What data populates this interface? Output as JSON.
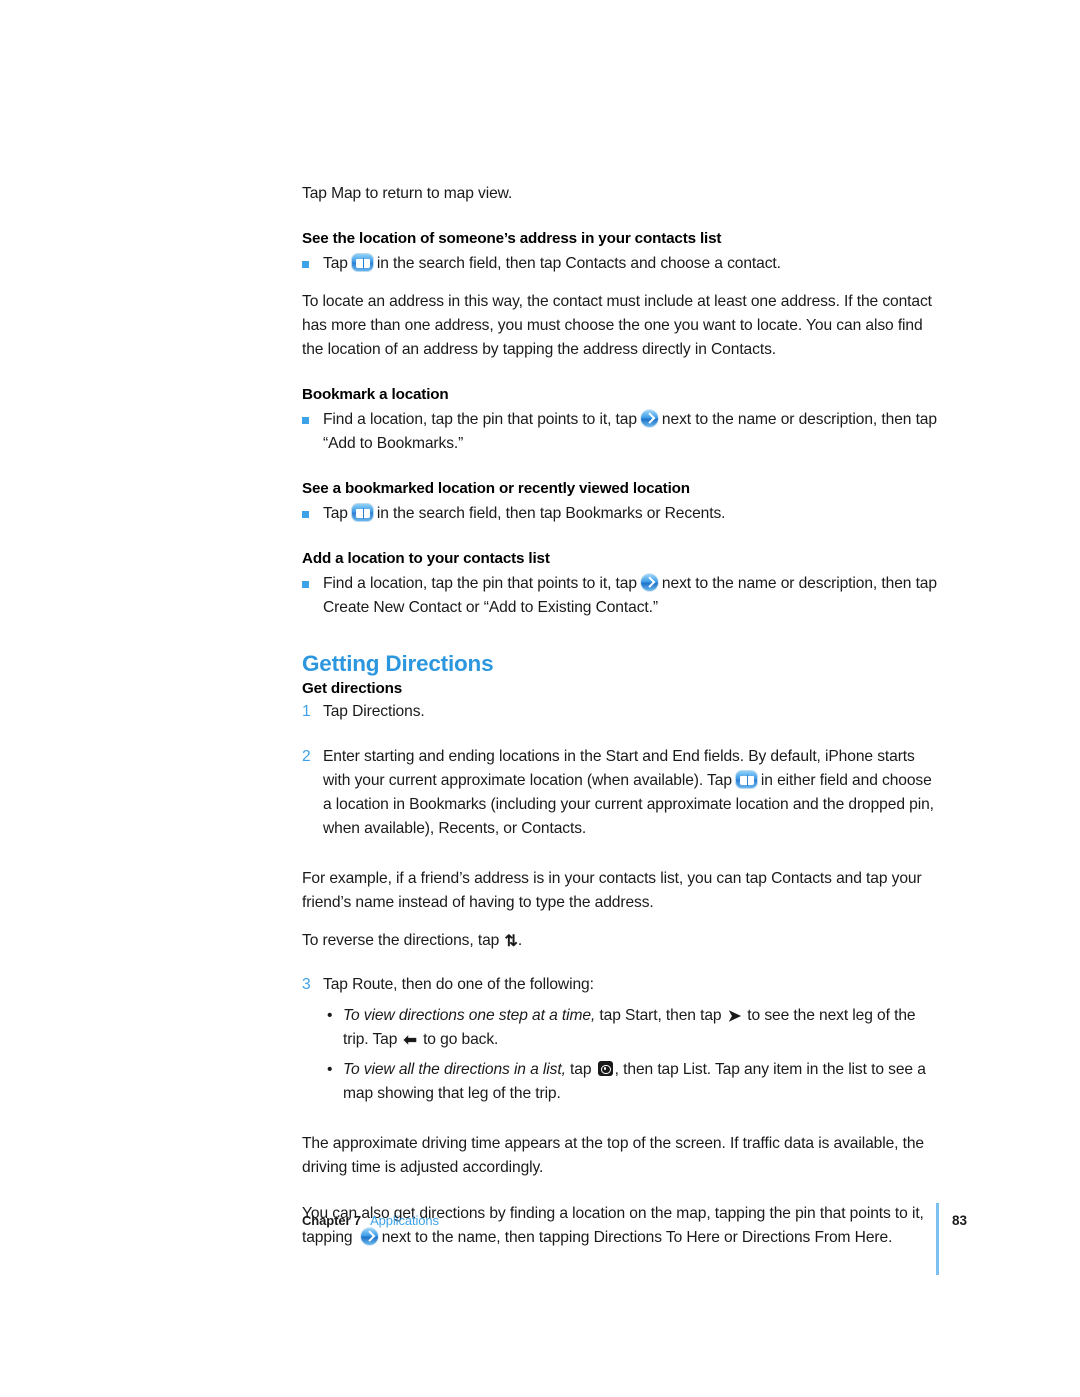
{
  "document": {
    "type": "user-guide-page",
    "page_number": "83"
  },
  "colors": {
    "accent_blue": "#3ea2e8",
    "heading_blue": "#2c97de",
    "rule_blue": "#7dc0ef",
    "body_text": "#1a1a1a"
  },
  "body": {
    "intro_para": "Tap Map to return to map view.",
    "tasks": [
      {
        "heading": "See the location of someone’s address in your contacts list",
        "bullet_prefix": "Tap",
        "icon": "bookmark-icon",
        "bullet_suffix": "in the search field, then tap Contacts and choose a contact.",
        "note": "To locate an address in this way, the contact must include at least one address. If the contact has more than one address, you must choose the one you want to locate. You can also find the location of an address by tapping the address directly in Contacts."
      },
      {
        "heading": "Bookmark a location",
        "bullet_prefix": "Find a location, tap the pin that points to it, tap",
        "icon": "disclosure-arrow-icon",
        "bullet_suffix": "next to the name or description, then tap “Add to Bookmarks.”"
      },
      {
        "heading": "See a bookmarked location or recently viewed location",
        "bullet_prefix": "Tap",
        "icon": "bookmark-icon",
        "bullet_suffix": "in the search field, then tap Bookmarks or Recents."
      },
      {
        "heading": "Add a location to your contacts list",
        "bullet_prefix": "Find a location, tap the pin that points to it, tap",
        "icon": "disclosure-arrow-icon",
        "bullet_suffix": "next to the name or description, then tap Create New Contact or “Add to Existing Contact.”"
      }
    ],
    "section": {
      "heading": "Getting Directions",
      "task_heading": "Get directions",
      "steps": [
        {
          "number": "1",
          "text": "Tap Directions."
        },
        {
          "number": "2",
          "text_before_icon": "Enter starting and ending locations in the Start and End fields. By default, iPhone starts with your current approximate location (when available). Tap",
          "icon": "bookmark-icon",
          "text_after_icon": "in either field and choose a location in Bookmarks (including your current approximate location and the dropped pin, when available), Recents, or Contacts."
        },
        {
          "number": "3",
          "text": "Tap Route, then do one of the following:"
        }
      ],
      "step2_note": "For example, if a friend’s address is in your contacts list, you can tap Contacts and tap your friend’s name instead of having to type the address.",
      "reverse_note_before": "To reverse the directions, tap",
      "reverse_icon": "reverse-directions-icon",
      "reverse_note_after": ".",
      "sub_bullets": [
        {
          "italic_lead": "To view directions one step at a time,",
          "text_1": "tap Start, then tap",
          "icon_1": "arrow-right-icon",
          "text_2": "to see the next leg of the trip. Tap",
          "icon_2": "arrow-left-icon",
          "text_3": "to go back."
        },
        {
          "italic_lead": "To view all the directions in a list,",
          "text_1": "tap",
          "icon_1": "options-icon",
          "text_2": ", then tap List. Tap any item in the list to see a map showing that leg of the trip."
        }
      ],
      "closing_note_1": "The approximate driving time appears at the top of the screen. If traffic data is available, the driving time is adjusted accordingly.",
      "closing_note_2_before": "You can also get directions by finding a location on the map, tapping the pin that points to it, tapping",
      "closing_note_2_icon": "disclosure-arrow-icon",
      "closing_note_2_after": "next to the name, then tapping Directions To Here or Directions From Here."
    }
  },
  "footer": {
    "chapter_label": "Chapter 7",
    "chapter_title": "Applications",
    "page_number": "83"
  }
}
